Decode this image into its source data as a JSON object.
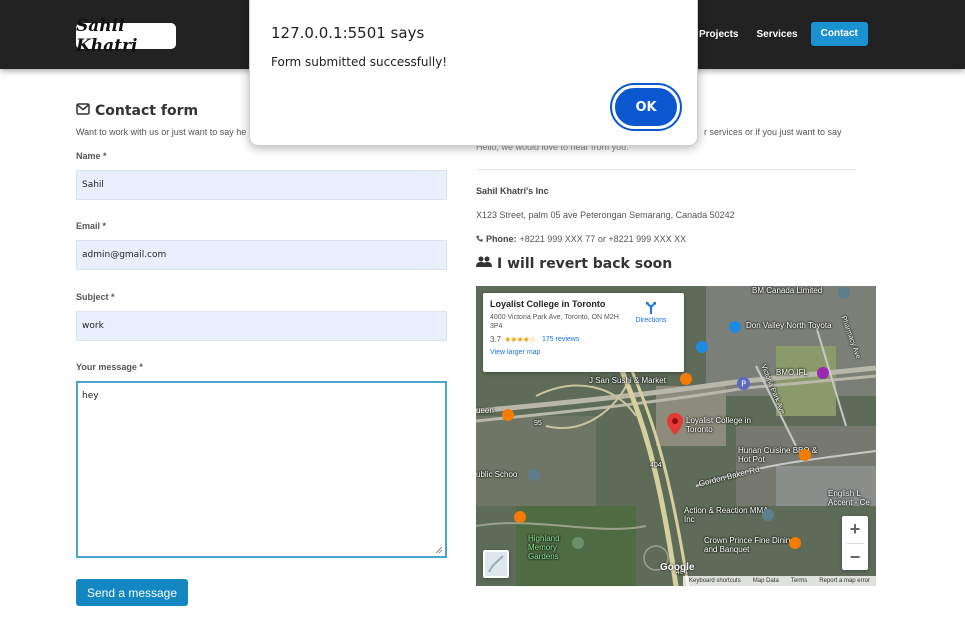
{
  "navbar": {
    "logo": "Sahil Khatri",
    "links": [
      "Projects",
      "Services",
      "Contact"
    ]
  },
  "contact_form": {
    "title": "Contact form",
    "description": "Want to work with us or just want to say he",
    "name_label": "Name *",
    "name_value": "Sahil",
    "email_label": "Email *",
    "email_value": "admin@gmail.com",
    "subject_label": "Subject *",
    "subject_value": "work",
    "message_label": "Your message *",
    "message_value": "hey",
    "submit_label": "Send a message"
  },
  "info": {
    "intro_line1": "r services or if you just want to say",
    "intro_line2": "Hello, we would love to hear from you.",
    "company": "Sahil Khatri's Inc",
    "address": "X123 Street, palm 05 ave Peterongan Semarang, Canada 50242",
    "phone_label": "Phone:",
    "phone_value": "+8221 999 XXX 77 or +8221 999 XXX XX",
    "revert_title": "I will revert back soon"
  },
  "map": {
    "place_name": "Loyalist College in Toronto",
    "place_address": "4000 Victoria Park Ave, Toronto, ON M2H 3P4",
    "rating": "3.7",
    "stars": "★★★★☆",
    "reviews": "175 reviews",
    "larger_map": "View larger map",
    "directions": "Directions",
    "labels": {
      "bmo_canada": "BM Canada Limited",
      "don_valley": "Don Valley North Toyota",
      "pharmacy": "Pharmacy Ave",
      "victoria_park": "Victoria Park Ave",
      "bmo_field": "BMO IFL",
      "j_san": "J San Sushi & Market",
      "loyalist": "Loyalist College in Toronto",
      "queen": "ueen",
      "public_school": "ublic Schoo",
      "hunan": "Hunan Cuisine BBQ & Hot Pot",
      "gordon_baker": "Gordon Baker Rd",
      "action_reaction": "Action & Reaction MMA Inc",
      "english": "English L Accent - Ce",
      "crown_prince": "Crown Prince Fine Dining and Banquet",
      "highland": "Highland Memory Gardens",
      "road_95": "95",
      "road_404": "404",
      "road_404b": "404"
    },
    "google": "Google",
    "attrib": [
      "Keyboard shortcuts",
      "Map Data",
      "Terms",
      "Report a map error"
    ]
  },
  "dialog": {
    "title": "127.0.0.1:5501 says",
    "message": "Form submitted successfully!",
    "ok": "OK"
  },
  "colors": {
    "navbar": "#222222",
    "accent": "#1a91d1",
    "send_button": "#1387c2",
    "dialog_ok": "#0b57d0",
    "field_bg": "#e8f0fe"
  }
}
